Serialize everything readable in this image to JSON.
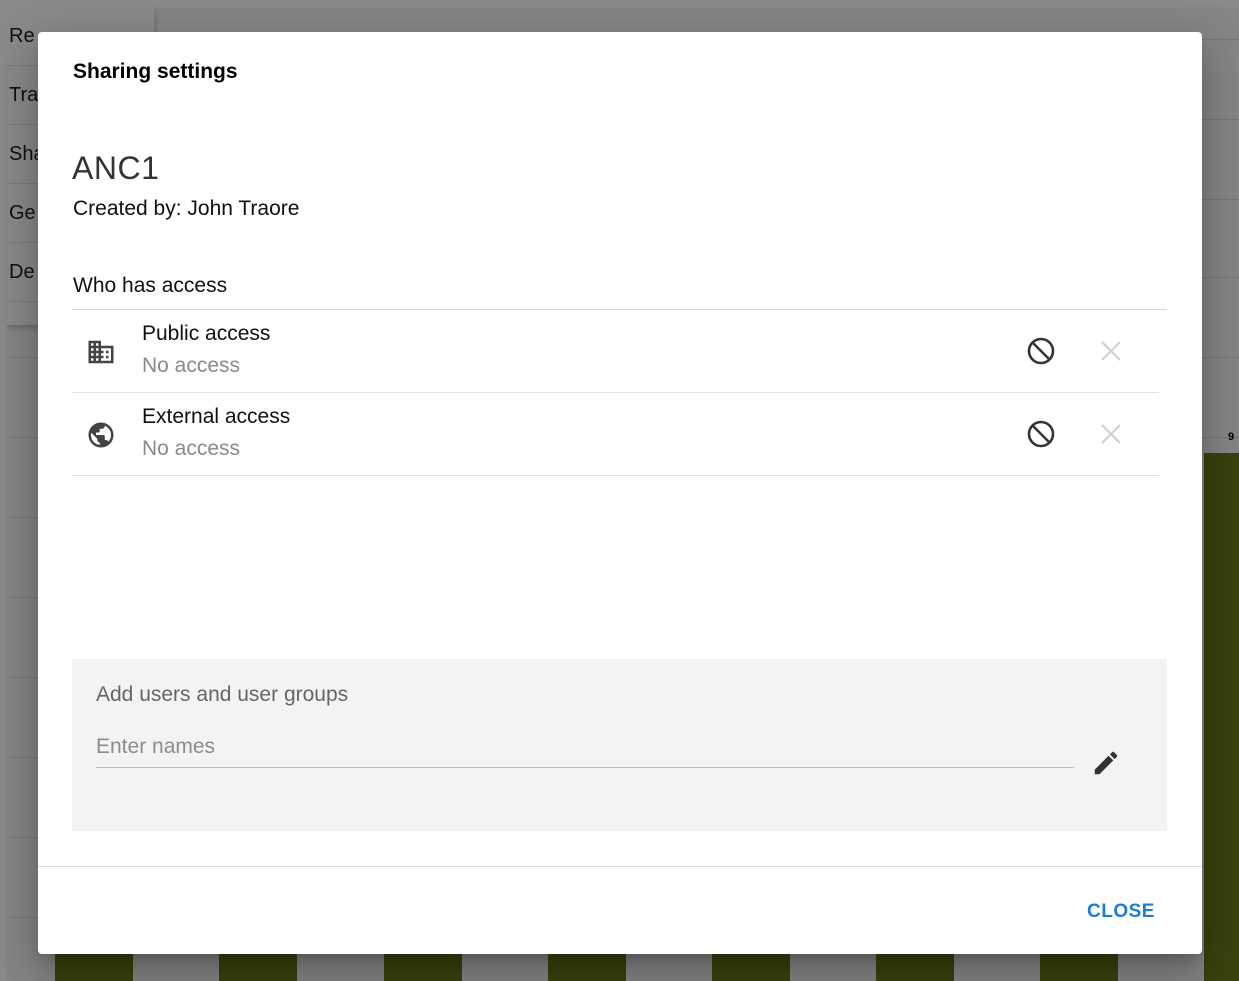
{
  "background": {
    "menu_items": [
      "Re",
      "Tra",
      "Sha",
      "Ge",
      "De"
    ],
    "bar_value_label": "9"
  },
  "dialog": {
    "title": "Sharing settings",
    "object_name": "ANC1",
    "created_by": "Created by: John Traore",
    "section_label": "Who has access",
    "access_rows": [
      {
        "name": "Public access",
        "level": "No access",
        "icon": "building-icon"
      },
      {
        "name": "External access",
        "level": "No access",
        "icon": "globe-icon"
      }
    ],
    "add_users": {
      "title": "Add users and user groups",
      "placeholder": "Enter names",
      "value": ""
    },
    "close_label": "CLOSE"
  },
  "colors": {
    "accent": "#1c7ed6",
    "bar": "#6b7a18"
  }
}
